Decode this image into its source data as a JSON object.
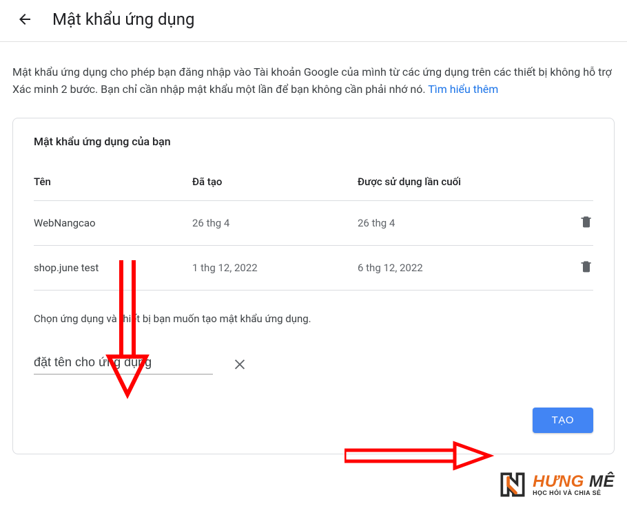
{
  "header": {
    "title": "Mật khẩu ứng dụng"
  },
  "intro": {
    "text": "Mật khẩu ứng dụng cho phép bạn đăng nhập vào Tài khoản Google của mình từ các ứng dụng trên các thiết bị không hỗ trợ Xác minh 2 bước. Bạn chỉ cần nhập mật khẩu một lần để bạn không cần phải nhớ nó. ",
    "learn_more": "Tìm hiểu thêm"
  },
  "card": {
    "heading": "Mật khẩu ứng dụng của bạn",
    "columns": {
      "name": "Tên",
      "created": "Đã tạo",
      "last_used": "Được sử dụng lần cuối"
    },
    "rows": [
      {
        "name": "WebNangcao",
        "created": "26 thg 4",
        "last_used": "26 thg 4"
      },
      {
        "name": "shop.june test",
        "created": "1 thg 12, 2022",
        "last_used": "6 thg 12, 2022"
      }
    ],
    "choose_text": "Chọn ứng dụng và thiết bị bạn muốn tạo mật khẩu ứng dụng.",
    "name_input_value": "đặt tên cho ứng dụng",
    "create_label": "TẠO"
  },
  "watermark": {
    "line1_a": "HƯNG",
    "line1_b": " MÊ",
    "line2": "HỌC HỎI VÀ CHIA SẺ"
  }
}
